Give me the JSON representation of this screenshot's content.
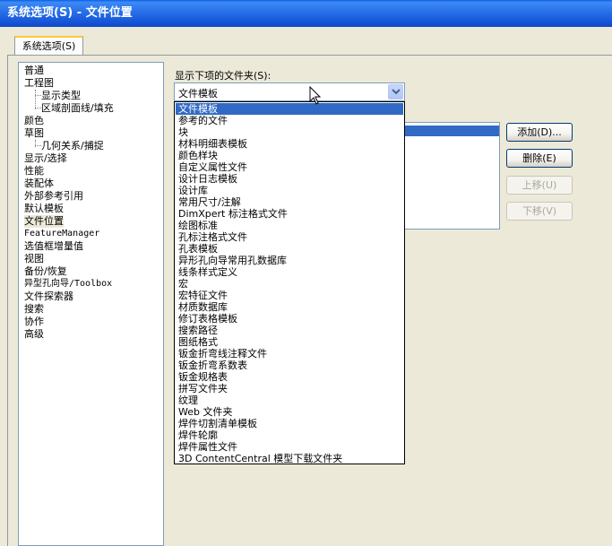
{
  "window": {
    "title": "系统选项(S) - 文件位置"
  },
  "tab": {
    "label": "系统选项(S)"
  },
  "tree": {
    "items": [
      {
        "label": "普通",
        "indent": 0
      },
      {
        "label": "工程图",
        "indent": 0
      },
      {
        "label": "显示类型",
        "indent": 1
      },
      {
        "label": "区域剖面线/填充",
        "indent": 1
      },
      {
        "label": "颜色",
        "indent": 0
      },
      {
        "label": "草图",
        "indent": 0
      },
      {
        "label": "几何关系/捕捉",
        "indent": 1
      },
      {
        "label": "显示/选择",
        "indent": 0
      },
      {
        "label": "性能",
        "indent": 0
      },
      {
        "label": "装配体",
        "indent": 0
      },
      {
        "label": "外部参考引用",
        "indent": 0
      },
      {
        "label": "默认模板",
        "indent": 0
      },
      {
        "label": "文件位置",
        "indent": 0,
        "selected": true
      },
      {
        "label": "FeatureManager",
        "indent": 0,
        "mono": true
      },
      {
        "label": "选值框增量值",
        "indent": 0
      },
      {
        "label": "视图",
        "indent": 0
      },
      {
        "label": "备份/恢复",
        "indent": 0
      },
      {
        "label": "异型孔向导/Toolbox",
        "indent": 0,
        "mono": true
      },
      {
        "label": "文件探索器",
        "indent": 0
      },
      {
        "label": "搜索",
        "indent": 0
      },
      {
        "label": "协作",
        "indent": 0
      },
      {
        "label": "高级",
        "indent": 0
      }
    ]
  },
  "folders": {
    "label": "显示下项的文件夹(S):",
    "selected": "文件模板",
    "options": [
      "文件模板",
      "参考的文件",
      "块",
      "材料明细表模板",
      "颜色样块",
      "自定义属性文件",
      "设计日志模板",
      "设计库",
      "常用尺寸/注解",
      "DimXpert 标注格式文件",
      "绘图标准",
      "孔标注格式文件",
      "孔表模板",
      "异形孔向导常用孔数据库",
      "线条样式定义",
      "宏",
      "宏特征文件",
      "材质数据库",
      "修订表格模板",
      "搜索路径",
      "图纸格式",
      "钣金折弯线注释文件",
      "钣金折弯系数表",
      "钣金规格表",
      "拼写文件夹",
      "纹理",
      "Web 文件夹",
      "焊件切割清单模板",
      "焊件轮廓",
      "焊件属性文件",
      "3D ContentCentral 模型下载文件夹"
    ]
  },
  "buttons": {
    "add": "添加(D)...",
    "delete": "删除(E)",
    "move_up": "上移(U)",
    "move_down": "下移(V)"
  },
  "colors": {
    "title_bar": "#1657D9",
    "selection": "#316AC5",
    "tab_accent": "#FFC83C"
  }
}
